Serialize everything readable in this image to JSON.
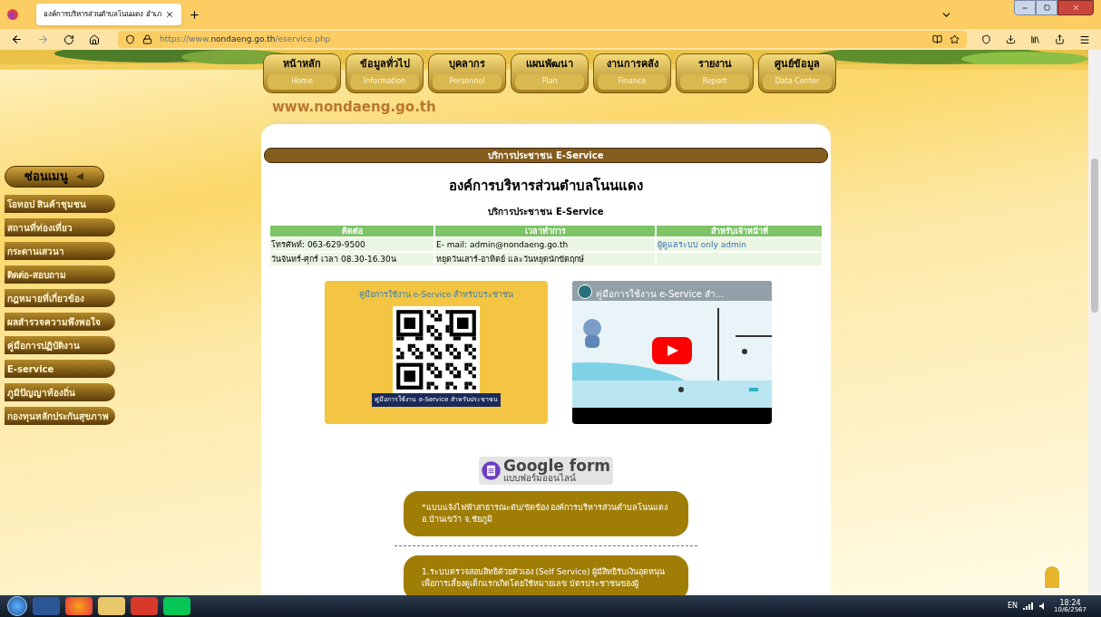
{
  "browser": {
    "tab_title": "องค์การบริหารส่วนตำบลโนนแดง อำเภ",
    "url_prefix": "https://www.",
    "url_domain": "nondaeng.go.th",
    "url_path": "/eservice.php"
  },
  "nav": [
    {
      "th": "หน้าหลัก",
      "en": "Home"
    },
    {
      "th": "ข้อมูลทั่วไป",
      "en": "Information"
    },
    {
      "th": "บุคลากร",
      "en": "Personnel"
    },
    {
      "th": "แผนพัฒนา",
      "en": "Plan"
    },
    {
      "th": "งานการคลัง",
      "en": "Finance"
    },
    {
      "th": "รายงาน",
      "en": "Report"
    },
    {
      "th": "ศูนย์ข้อมูล",
      "en": "Data Center"
    }
  ],
  "banner_url": "www.nondaeng.go.th",
  "sidebar": {
    "toggle_label": "ซ่อนเมนู",
    "items": [
      "โอทอป สินค้าชุมชน",
      "สถานที่ท่องเที่ยว",
      "กระดานเสวนา",
      "ติดต่อ-สอบถาม",
      "กฎหมายที่เกี่ยวข้อง",
      "ผลสำรวจความพึงพอใจ",
      "คู่มือการปฏิบัติงาน",
      "E-service",
      "ภูมิปัญญาท้องถิ่น",
      "กองทุนหลักประกันสุขภาพ"
    ]
  },
  "content": {
    "section_header": "บริการประชาชน E-Service",
    "org_title": "องค์การบริหารส่วนตำบลโนนแดง",
    "subtitle": "บริการประชาชน E-Service",
    "table": {
      "columns": [
        "ติดต่อ",
        "เวลาทำการ",
        "สำหรับเจ้าหน้าที่"
      ],
      "rows": [
        [
          {
            "kind": "text",
            "text": "โทรศัพท์: 063-629-9500"
          },
          {
            "kind": "text",
            "text": "E- mail: admin@nondaeng.go.th"
          },
          {
            "kind": "link",
            "text": "ผู้ดูแลระบบ only admin"
          }
        ],
        [
          {
            "kind": "text",
            "text": "วันจันทร์-ศุกร์ เวลา 08.30-16.30น"
          },
          {
            "kind": "text",
            "text": "หยุดวันเสาร์-อาทิตย์ และวันหยุดนักขัตฤกษ์"
          }
        ]
      ]
    },
    "qr_card": {
      "title": "คู่มือการใช้งาน e-Service สำหรับประชาชน",
      "caption": "คู่มือการใช้งาน e-Service สำหรับประชาชน"
    },
    "video": {
      "title": "คู่มือการใช้งาน e-Service สำ..."
    },
    "google_form": {
      "title": "Google form",
      "subtitle": "แบบฟอร์มออนไลน์"
    },
    "services": [
      "*แบบแจ้งไฟฟ้าสาธารณะดับ/ขัดข้อง องค์การบริหารส่วนตำบลโนนแดง อ.บ้านเขว้า จ.ชัยภูมิ",
      "1.ระบบตรวจสอบสิทธิด้วยตัวเอง (Self Service) ผู้มีสิทธิรับเงินอุดหนุนเพื่อการเลี้ยงดูเด็กแรกเกิดโดยใช้หมายเลข บัตรประชาชนของผู้"
    ]
  },
  "taskbar": {
    "language": "EN",
    "time": "18:24",
    "date": "10/6/2567"
  }
}
